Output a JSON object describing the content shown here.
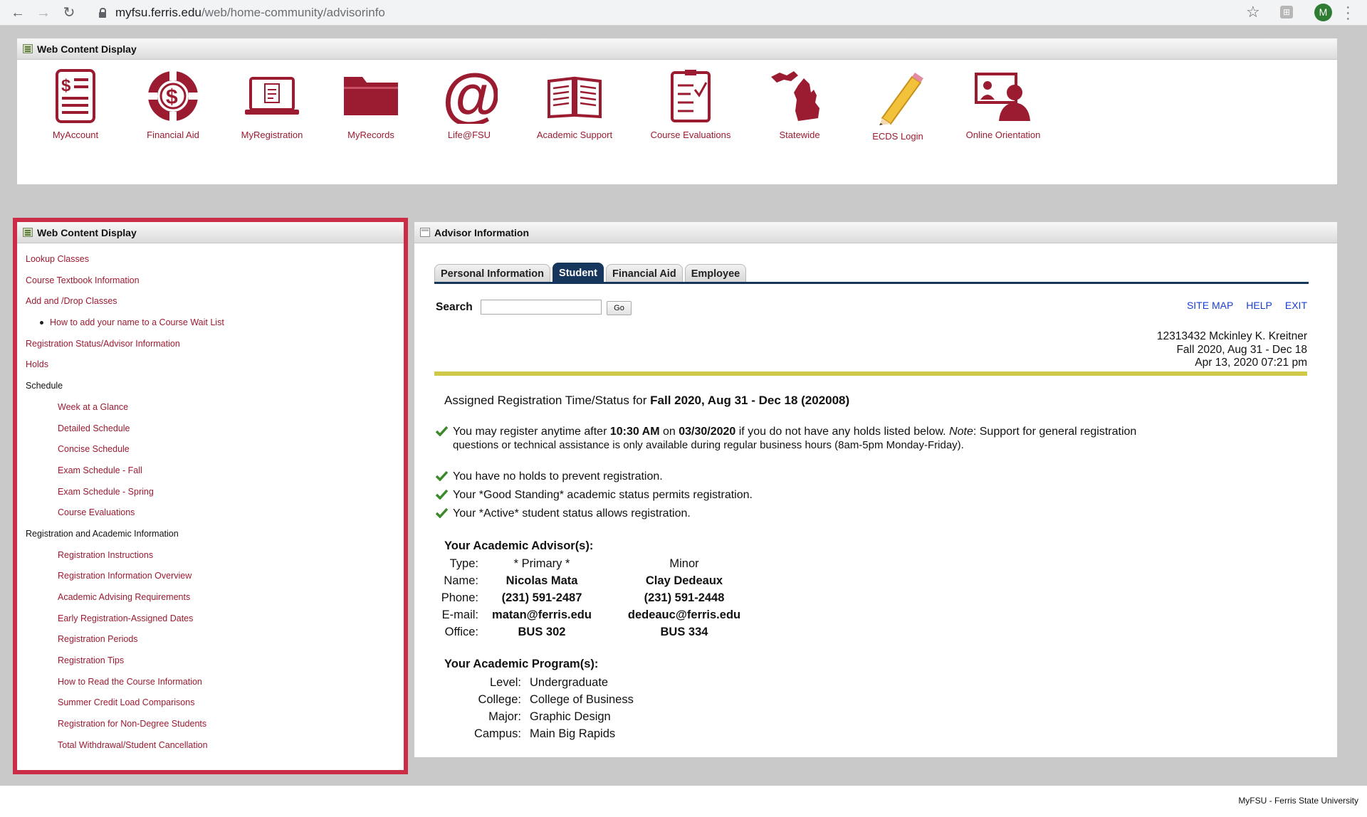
{
  "browser": {
    "url_host": "myfsu.ferris.edu",
    "url_path": "/web/home-community/advisorinfo",
    "profile_initial": "M"
  },
  "top_portlet": {
    "title": "Web Content Display",
    "icons": [
      {
        "label": "MyAccount",
        "icon": "account-statement-icon"
      },
      {
        "label": "Financial Aid",
        "icon": "lifebuoy-dollar-icon"
      },
      {
        "label": "MyRegistration",
        "icon": "laptop-document-icon"
      },
      {
        "label": "MyRecords",
        "icon": "folder-icon"
      },
      {
        "label": "Life@FSU",
        "icon": "at-sign-icon"
      },
      {
        "label": "Academic Support",
        "icon": "open-book-icon"
      },
      {
        "label": "Course Evaluations",
        "icon": "checklist-icon"
      },
      {
        "label": "Statewide",
        "icon": "michigan-map-icon"
      },
      {
        "label": "ECDS Login",
        "icon": "pencil-icon"
      },
      {
        "label": "Online Orientation",
        "icon": "presenter-screen-icon"
      }
    ]
  },
  "left_portlet": {
    "title": "Web Content Display",
    "items": [
      {
        "label": "Lookup Classes",
        "level": "l0",
        "link": true
      },
      {
        "label": "Course Textbook Information",
        "level": "l0",
        "link": true
      },
      {
        "label": "Add and /Drop Classes",
        "level": "l0",
        "link": true
      },
      {
        "label": "How to add your name to a Course Wait List",
        "level": "bullet",
        "link": true
      },
      {
        "label": "Registration Status/Advisor Information",
        "level": "l0",
        "link": true
      },
      {
        "label": "Holds",
        "level": "l0",
        "link": true
      },
      {
        "label": "Schedule",
        "level": "l0",
        "link": false
      },
      {
        "label": "Week at a Glance",
        "level": "l1",
        "link": true
      },
      {
        "label": "Detailed Schedule",
        "level": "l1",
        "link": true
      },
      {
        "label": "Concise Schedule",
        "level": "l1",
        "link": true
      },
      {
        "label": "Exam Schedule - Fall",
        "level": "l1",
        "link": true
      },
      {
        "label": "Exam Schedule - Spring",
        "level": "l1",
        "link": true
      },
      {
        "label": "Course Evaluations",
        "level": "l1",
        "link": true
      },
      {
        "label": "Registration and Academic Information",
        "level": "l0",
        "link": false
      },
      {
        "label": "Registration Instructions",
        "level": "l1",
        "link": true
      },
      {
        "label": "Registration Information Overview",
        "level": "l1",
        "link": true
      },
      {
        "label": "Academic Advising Requirements",
        "level": "l1",
        "link": true
      },
      {
        "label": "Early Registration-Assigned Dates",
        "level": "l1",
        "link": true
      },
      {
        "label": "Registration Periods",
        "level": "l1",
        "link": true
      },
      {
        "label": "Registration Tips",
        "level": "l1",
        "link": true
      },
      {
        "label": "How to Read the Course Information",
        "level": "l1",
        "link": true
      },
      {
        "label": "Summer Credit Load Comparisons",
        "level": "l1",
        "link": true
      },
      {
        "label": "Registration for Non-Degree Students",
        "level": "l1",
        "link": true
      },
      {
        "label": "Total Withdrawal/Student Cancellation",
        "level": "l1",
        "link": true
      }
    ]
  },
  "advisor_portlet": {
    "title": "Advisor Information",
    "tabs": [
      {
        "label": "Personal Information",
        "active": false
      },
      {
        "label": "Student",
        "active": true
      },
      {
        "label": "Financial Aid",
        "active": false
      },
      {
        "label": "Employee",
        "active": false
      }
    ],
    "search_label": "Search",
    "search_value": "",
    "go_label": "Go",
    "links": {
      "site_map": "SITE MAP",
      "help": "HELP",
      "exit": "EXIT"
    },
    "student_line1": "12313432 Mckinley K. Kreitner",
    "student_line2": "Fall 2020, Aug 31 - Dec 18",
    "student_line3": "Apr 13, 2020 07:21 pm",
    "reg_title_prefix": "Assigned Registration Time/Status for",
    "reg_title_term": "Fall 2020, Aug 31 - Dec 18 (202008)",
    "msg1_a": "You may register anytime after",
    "msg1_time": "10:30 AM",
    "msg1_on": "on",
    "msg1_date": "03/30/2020",
    "msg1_b": "if you do not have any holds listed below.",
    "msg1_note": "Note",
    "msg1_c": ": Support for general registration",
    "msg1_line2": "questions or technical assistance is only available during regular business hours (8am-5pm Monday-Friday).",
    "msg2": "You have no holds to prevent registration.",
    "msg3": "Your *Good Standing* academic status permits registration.",
    "msg4": "Your *Active* student status allows registration.",
    "advisors_title": "Your Academic Advisor(s):",
    "advisor_labels": {
      "type": "Type:",
      "name": "Name:",
      "phone": "Phone:",
      "email": "E-mail:",
      "office": "Office:"
    },
    "advisors": [
      {
        "type": "* Primary *",
        "name": "Nicolas Mata",
        "phone": "(231) 591-2487",
        "email": "matan@ferris.edu",
        "office": "BUS 302"
      },
      {
        "type": "Minor",
        "name": "Clay Dedeaux",
        "phone": "(231) 591-2448",
        "email": "dedeauc@ferris.edu",
        "office": "BUS 334"
      }
    ],
    "programs_title": "Your Academic Program(s):",
    "program": {
      "level_label": "Level:",
      "level": "Undergraduate",
      "college_label": "College:",
      "college": "College of Business",
      "major_label": "Major:",
      "major": "Graphic Design",
      "campus_label": "Campus:",
      "campus": "Main Big Rapids"
    }
  },
  "footer": "MyFSU - Ferris State University",
  "colors": {
    "brand": "#9b1b30",
    "highlight": "#cc2d46",
    "tab_active": "#17365d",
    "rule": "#cfc94a",
    "check": "#3a8a2a"
  }
}
